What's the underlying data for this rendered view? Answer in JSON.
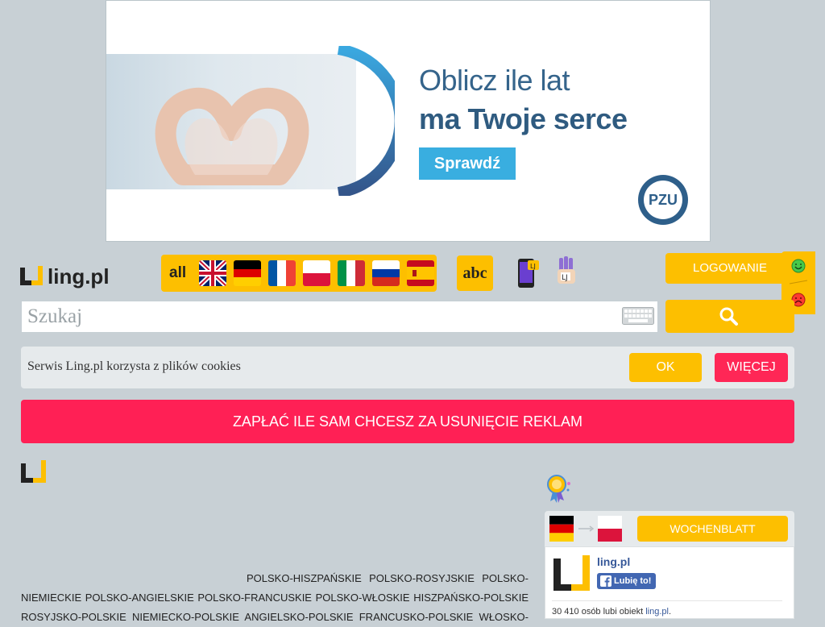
{
  "ad": {
    "headline_line1": "Oblicz ile lat",
    "headline_line2": "ma Twoje serce",
    "button_label": "Sprawdź",
    "brand_logo": "PZU"
  },
  "header": {
    "logo_text": "ling.pl",
    "lang_all_label": "all",
    "languages": [
      "english-flag",
      "german-flag",
      "french-flag",
      "polish-flag",
      "italian-flag",
      "russian-flag",
      "spanish-flag"
    ],
    "abc_label": "abc",
    "login_label": "LOGOWANIE",
    "accent_color": "#fdbf00"
  },
  "search": {
    "placeholder": "Szukaj"
  },
  "cookies": {
    "text": "Serwis Ling.pl korzysta z plików cookies",
    "ok_label": "OK",
    "more_label": "WIĘCEJ"
  },
  "promo": {
    "label": "ZAPŁAĆ ILE SAM CHCESZ ZA USUNIĘCIE REKLAM",
    "color": "#ff2055"
  },
  "dictionaries": {
    "row1": [
      "POLSKO-HISZPAŃSKIE",
      "POLSKO-ROSYJSKIE",
      "POLSKO-"
    ],
    "row2": [
      "NIEMIECKIE",
      "POLSKO-ANGIELSKIE",
      "POLSKO-FRANCUSKIE",
      "POLSKO-WŁOSKIE",
      "HISZPAŃSKO-POLSKIE"
    ],
    "row3": [
      "ROSYJSKO-POLSKIE",
      "NIEMIECKO-POLSKIE",
      "ANGIELSKO-POLSKIE",
      "FRANCUSKO-POLSKIE",
      "WŁOSKO-"
    ]
  },
  "wochenblatt": {
    "label": "WOCHENBLATT"
  },
  "facebook": {
    "page_name": "ling.pl",
    "like_label": "Lubię to!",
    "count_prefix": "30 410 osób lubi obiekt ",
    "count_link": "ling.pl",
    "count_suffix": "."
  }
}
